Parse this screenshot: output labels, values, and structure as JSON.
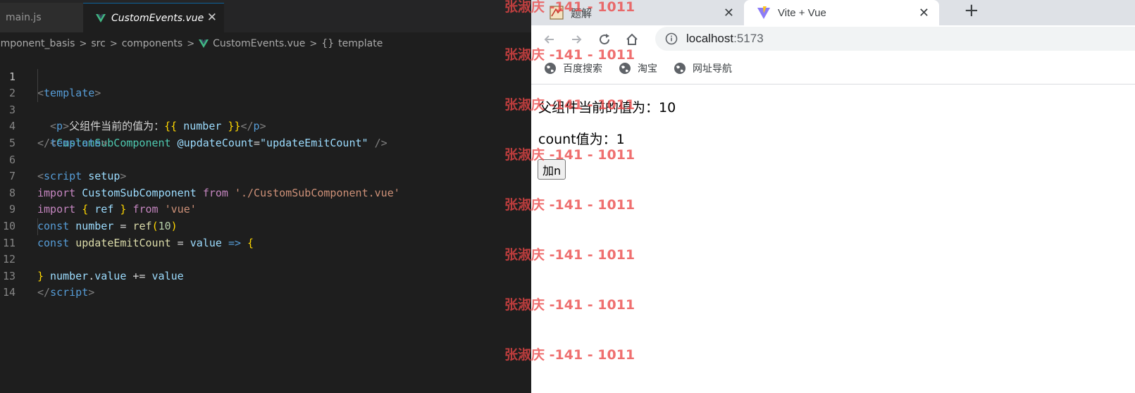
{
  "editor": {
    "tabs": [
      {
        "label": "main.js"
      },
      {
        "label": "CustomEvents.vue",
        "close": "✕"
      }
    ],
    "breadcrumb": {
      "project": "omponent_basis",
      "src": "src",
      "components": "components",
      "file": "CustomEvents.vue",
      "symbol_icon": "{}",
      "symbol": "template",
      "sep": ">"
    },
    "code_lines": [
      {
        "n": "1"
      },
      {
        "n": "2"
      },
      {
        "n": "3"
      },
      {
        "n": "4"
      },
      {
        "n": "5"
      },
      {
        "n": "6"
      },
      {
        "n": "7"
      },
      {
        "n": "8"
      },
      {
        "n": "9"
      },
      {
        "n": "10"
      },
      {
        "n": "11"
      },
      {
        "n": "12"
      },
      {
        "n": "13"
      },
      {
        "n": "14"
      }
    ],
    "code": {
      "l1": [
        "<",
        "template",
        ">"
      ],
      "l2": [
        "<",
        "p",
        ">",
        "父组件当前的值为：",
        "{{",
        " number ",
        "}}",
        "</",
        "p",
        ">"
      ],
      "l3": [
        "<",
        "CustomSubComponent",
        " ",
        "@updateCount",
        "=",
        "\"updateEmitCount\"",
        " />"
      ],
      "l4": [
        "</",
        "template",
        ">"
      ],
      "l6": [
        "<",
        "script",
        " ",
        "setup",
        ">"
      ],
      "l7": [
        "import",
        " ",
        "CustomSubComponent",
        " ",
        "from",
        " ",
        "'./CustomSubComponent.vue'"
      ],
      "l8": [
        "import",
        " ",
        "{",
        " ",
        "ref",
        " ",
        "}",
        " ",
        "from",
        " ",
        "'vue'"
      ],
      "l9": [
        "const",
        " ",
        "number",
        " = ",
        "ref",
        "(",
        "10",
        ")"
      ],
      "l10": [
        "const",
        " ",
        "updateEmitCount",
        " = ",
        "value",
        " ",
        "=>",
        " ",
        "{"
      ],
      "l11": [
        "number",
        ".",
        "value",
        " += ",
        "value"
      ],
      "l12": [
        "}"
      ],
      "l13": [
        "</",
        "script",
        ">"
      ]
    }
  },
  "browser": {
    "tabs": [
      {
        "title": "题解",
        "close": "✕"
      },
      {
        "title": "Vite + Vue",
        "close": "✕"
      }
    ],
    "new_tab": "+",
    "url_host": "localhost",
    "url_port": ":5173",
    "bookmarks": [
      "百度搜索",
      "淘宝",
      "网址导航"
    ],
    "page": {
      "parent_label": "父组件当前的值为：",
      "parent_value": "10",
      "count_label": "count值为：",
      "count_value": "1",
      "button": "加n"
    }
  },
  "watermark": "张淑庆 -141 - 1011",
  "colors": {
    "editor_bg": "#1e1e1e",
    "vue_green": "#41b883",
    "watermark": "#eb4646",
    "browser_tab_strip": "#dee1e6"
  },
  "icons": {
    "back": "arrow-left-icon",
    "forward": "arrow-right-icon",
    "reload": "reload-icon",
    "home": "home-icon",
    "site_info": "info-icon",
    "bookmark": "globe-icon"
  }
}
